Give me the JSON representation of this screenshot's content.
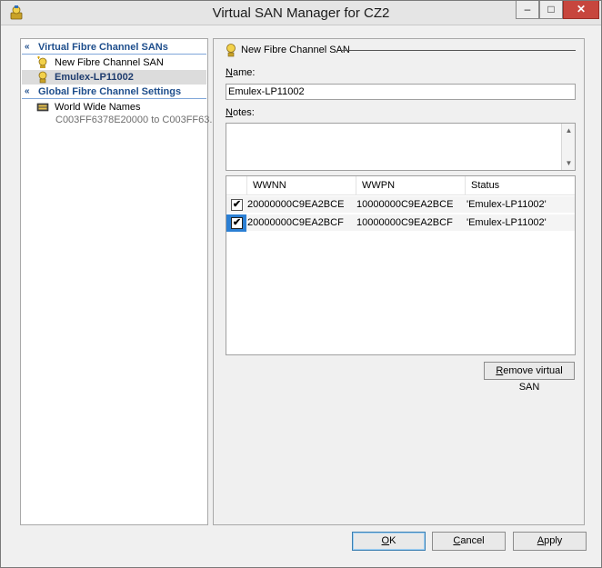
{
  "window": {
    "title": "Virtual SAN Manager for CZ2",
    "minimize_glyph": "–",
    "maximize_glyph": "□",
    "close_glyph": "✕"
  },
  "nav": {
    "group1": {
      "label": "Virtual Fibre Channel SANs",
      "chevron": "«"
    },
    "items": [
      {
        "label": "New Fibre Channel SAN",
        "icon": "new-san-icon"
      },
      {
        "label": "Emulex-LP11002",
        "icon": "san-icon",
        "selected": true
      }
    ],
    "group2": {
      "label": "Global Fibre Channel Settings",
      "chevron": "«"
    },
    "wwn": {
      "label": "World Wide Names",
      "range": "C003FF6378E20000 to C003FF63..."
    }
  },
  "detail": {
    "section_title": "New Fibre Channel SAN",
    "name_label_accel": "N",
    "name_label_rest": "ame:",
    "name_value": "Emulex-LP11002",
    "notes_label_accel": "N",
    "notes_label_rest": "otes:",
    "notes_value": "",
    "table": {
      "columns": [
        "WWNN",
        "WWPN",
        "Status"
      ],
      "rows": [
        {
          "checked": true,
          "wwnn": "20000000C9EA2BCE",
          "wwpn": "10000000C9EA2BCE",
          "status": "'Emulex-LP11002'"
        },
        {
          "checked": true,
          "wwnn": "20000000C9EA2BCF",
          "wwpn": "10000000C9EA2BCF",
          "status": "'Emulex-LP11002'"
        }
      ],
      "check_glyph": "✔"
    },
    "remove_button": {
      "accel": "R",
      "rest": "emove virtual SAN"
    }
  },
  "footer": {
    "ok": {
      "accel": "O",
      "rest": "K"
    },
    "cancel": {
      "accel": "C",
      "rest": "ancel"
    },
    "apply": {
      "accel": "A",
      "rest": "pply"
    }
  },
  "colors": {
    "nav_header": "#1e4e8c",
    "selection_focus": "#2b7fd4",
    "close_button": "#c7463d"
  }
}
